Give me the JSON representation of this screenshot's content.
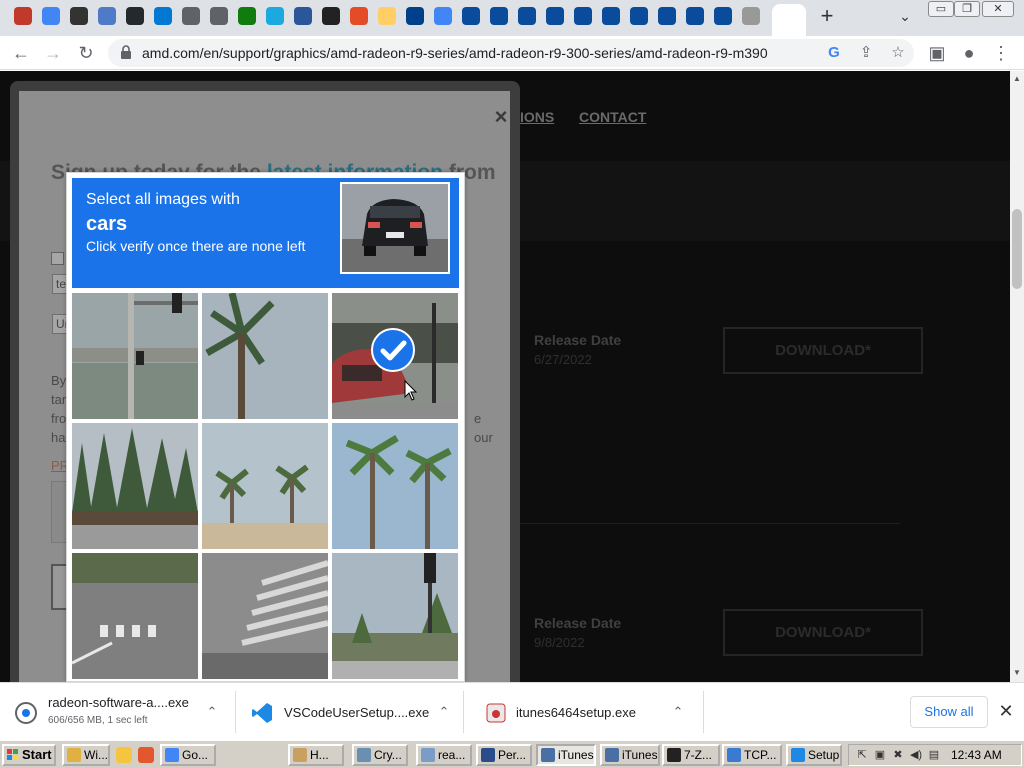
{
  "browser": {
    "url": "amd.com/en/support/graphics/amd-radeon-r9-series/amd-radeon-r9-300-series/amd-radeon-r9-m390",
    "tab_close": "✕",
    "new_tab": "+",
    "tab_list": "⌄",
    "window_buttons": [
      "▭",
      "❐",
      "✕"
    ],
    "favicon_colors": [
      "#c0392b",
      "#4285f4",
      "#333333",
      "#4e7ac7",
      "#24292e",
      "#0078d4",
      "#5f6368",
      "#5f6368",
      "#107c10",
      "#1ba9e0",
      "#2b579a",
      "#222222",
      "#e34c26",
      "#ffcf66",
      "#003f8a",
      "#4285f4",
      "#0a4b9b",
      "#0a4b9b",
      "#0a4b9b",
      "#0a4b9b",
      "#0a4b9b",
      "#0a4b9b",
      "#0a4b9b",
      "#0a4b9b",
      "#0a4b9b",
      "#0a4b9b",
      "#999999"
    ]
  },
  "page": {
    "nav": [
      "IONS",
      "CONTACT"
    ],
    "releases": [
      {
        "label": "Release Date",
        "date": "6/27/2022",
        "button": "DOWNLOAD*"
      },
      {
        "label": "Release Date",
        "date": "9/8/2022",
        "button": "DOWNLOAD*"
      }
    ]
  },
  "modal": {
    "close": "×",
    "heading_start": "Sign up today for the ",
    "heading_highlight": "latest information",
    "heading_end": " from",
    "check_label": "Y",
    "input1_value": "tez",
    "input2_placeholder": "Uni",
    "body_lines": [
      "By s",
      "targ",
      "fron",
      "han"
    ],
    "body_right": [
      "e",
      "our"
    ],
    "privacy_link": "PRI"
  },
  "captcha": {
    "line1": "Select all images with",
    "target": "cars",
    "line3": "Click verify once there are none left",
    "tiles": [
      {
        "label": "traffic-light-bridge",
        "selected": false
      },
      {
        "label": "palm-tree",
        "selected": false
      },
      {
        "label": "red-car",
        "selected": true
      },
      {
        "label": "trees-road",
        "selected": false
      },
      {
        "label": "palms-sky",
        "selected": false
      },
      {
        "label": "tall-palms",
        "selected": false
      },
      {
        "label": "crosswalk-street",
        "selected": false
      },
      {
        "label": "crosswalk-road",
        "selected": false
      },
      {
        "label": "traffic-light-street",
        "selected": false
      }
    ]
  },
  "downloads": [
    {
      "name": "radeon-software-a....exe",
      "sub": "606/656 MB, 1 sec left",
      "icon": "radeon-icon"
    },
    {
      "name": "VSCodeUserSetup....exe",
      "sub": "",
      "icon": "vscode-icon"
    },
    {
      "name": "itunes6464setup.exe",
      "sub": "",
      "icon": "itunes-icon"
    }
  ],
  "shelf": {
    "show_all": "Show all",
    "close": "✕",
    "chevron": "⌃"
  },
  "taskbar": {
    "start": "Start",
    "tasks": [
      {
        "label": "Wi...",
        "color": "#e0b040"
      },
      {
        "label": "Go...",
        "color": "#4285f4"
      },
      {
        "label": "H...",
        "color": "#c8a060"
      },
      {
        "label": "Cry...",
        "color": "#6b8fb3"
      },
      {
        "label": "rea...",
        "color": "#7a9cc6"
      },
      {
        "label": "Per...",
        "color": "#2a4c8a"
      },
      {
        "label": "iTunes",
        "color": "#4a6fa5"
      },
      {
        "label": "iTunes",
        "color": "#4a6fa5"
      },
      {
        "label": "7-Z...",
        "color": "#222222"
      },
      {
        "label": "TCP...",
        "color": "#3a7ad0"
      },
      {
        "label": "Setup",
        "color": "#1e88e5"
      }
    ],
    "clock": "12:43 AM",
    "tray": [
      "⇱",
      "▣",
      "✖",
      "◀)",
      "▤"
    ]
  }
}
